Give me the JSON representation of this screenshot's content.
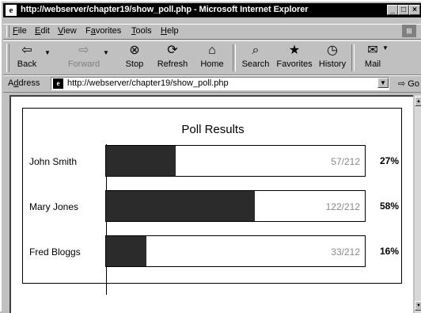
{
  "window": {
    "title": "http://webserver/chapter19/show_poll.php - Microsoft Internet Explorer",
    "buttons": [
      "_",
      "□",
      "×"
    ]
  },
  "menu": [
    {
      "label": "File",
      "accel": "F",
      "rest": "ile"
    },
    {
      "label": "Edit",
      "accel": "E",
      "rest": "dit"
    },
    {
      "label": "View",
      "accel": "V",
      "rest": "iew"
    },
    {
      "label": "Favorites",
      "accel": "a",
      "pre": "F",
      "rest": "vorites"
    },
    {
      "label": "Tools",
      "accel": "T",
      "rest": "ools"
    },
    {
      "label": "Help",
      "accel": "H",
      "rest": "elp"
    }
  ],
  "toolbar": {
    "back": "Back",
    "forward": "Forward",
    "stop": "Stop",
    "refresh": "Refresh",
    "home": "Home",
    "search": "Search",
    "favorites": "Favorites",
    "history": "History",
    "mail": "Mail"
  },
  "address": {
    "label_accel": "d",
    "label_pre": "A",
    "label_rest": "dress",
    "url": "http://webserver/chapter19/show_poll.php",
    "go": "Go"
  },
  "poll": {
    "title": "Poll Results",
    "total": 212,
    "results": [
      {
        "name": "John Smith",
        "votes": 57,
        "count_label": "57/212",
        "percent_label": "27%"
      },
      {
        "name": "Mary Jones",
        "votes": 122,
        "count_label": "122/212",
        "percent_label": "58%"
      },
      {
        "name": "Fred Bloggs",
        "votes": 33,
        "count_label": "33/212",
        "percent_label": "16%"
      }
    ]
  },
  "colors": {
    "bar_fill": "#2b2b2b",
    "count_text": "#8a8a8a"
  }
}
